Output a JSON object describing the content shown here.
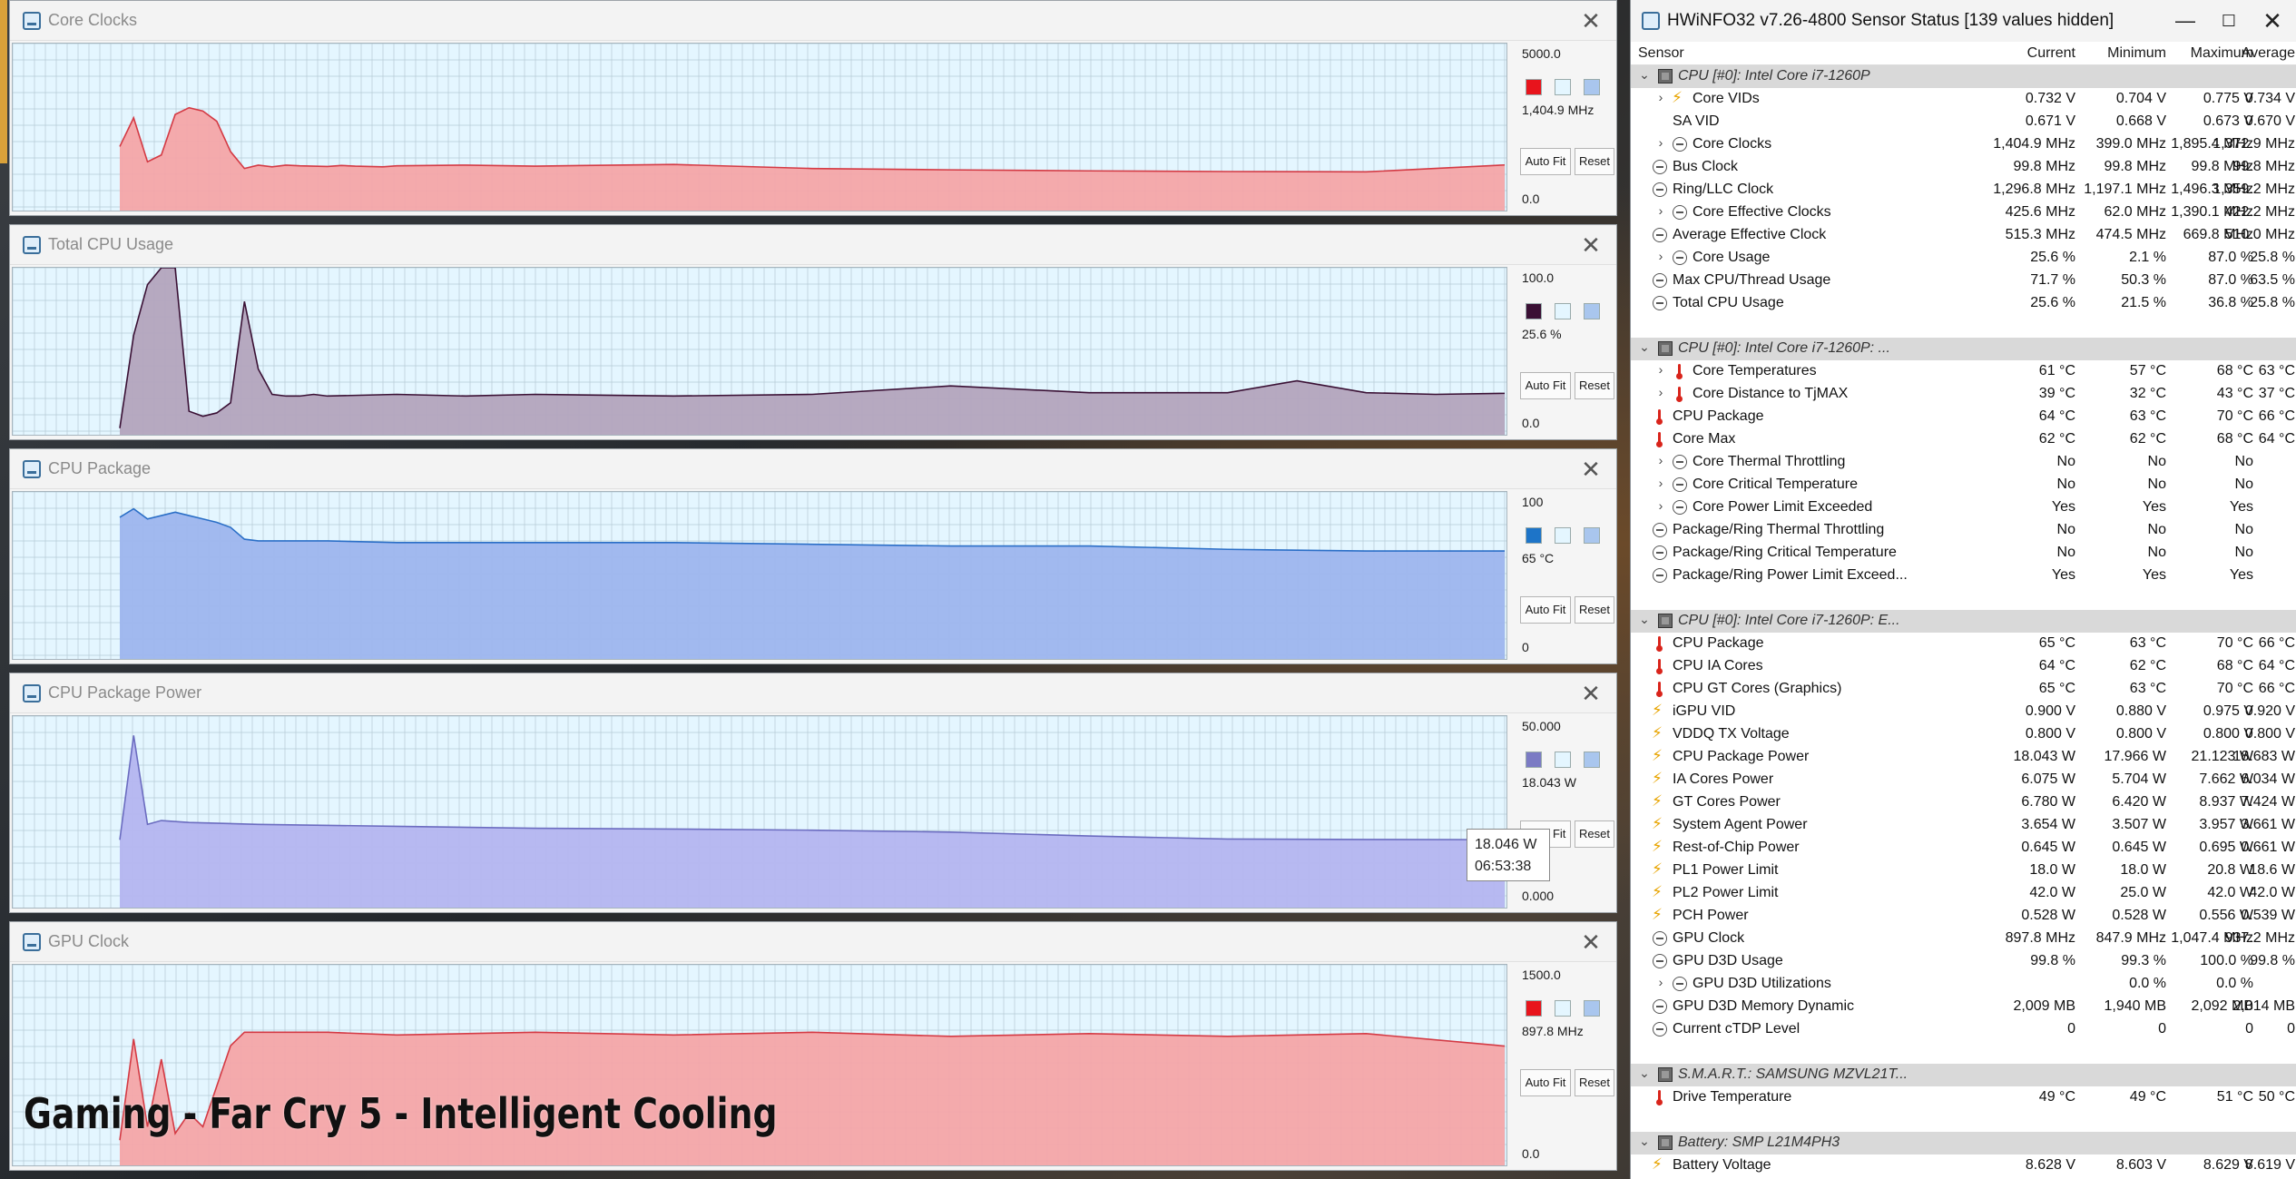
{
  "graph_windows": [
    {
      "title": "Core Clocks",
      "ymax": "5000.0",
      "ymin": "0.0",
      "current": "1,404.9 MHz",
      "series_color": "#e8141c",
      "fill": "#f4a5a8",
      "line": "#d43a44",
      "buttons": {
        "autofit": "Auto Fit",
        "reset": "Reset"
      },
      "chart_data": {
        "type": "area",
        "ylim": [
          0,
          5000
        ],
        "x": [
          0,
          1,
          2,
          3,
          4,
          5,
          6,
          7,
          8,
          9,
          10,
          11,
          12,
          13,
          14,
          15,
          16,
          17,
          18,
          19,
          20,
          25,
          30,
          40,
          50,
          60,
          70,
          80,
          90,
          100
        ],
        "values": [
          1950,
          2800,
          1500,
          1700,
          2900,
          3100,
          3000,
          2700,
          1800,
          1300,
          1400,
          1350,
          1400,
          1380,
          1370,
          1360,
          1390,
          1370,
          1360,
          1350,
          1380,
          1400,
          1370,
          1420,
          1300,
          1260,
          1230,
          1210,
          1200,
          1404.9
        ]
      }
    },
    {
      "title": "Total CPU Usage",
      "ymax": "100.0",
      "ymin": "0.0",
      "current": "25.6 %",
      "series_color": "#3a1034",
      "fill": "#b3a4bd",
      "line": "#3a1034",
      "buttons": {
        "autofit": "Auto Fit",
        "reset": "Reset"
      },
      "chart_data": {
        "type": "area",
        "ylim": [
          0,
          100
        ],
        "x": [
          0,
          1,
          2,
          3,
          4,
          5,
          6,
          7,
          8,
          9,
          10,
          11,
          12,
          13,
          14,
          15,
          20,
          25,
          30,
          40,
          50,
          60,
          70,
          80,
          85,
          90,
          95,
          100
        ],
        "values": [
          5,
          60,
          90,
          100,
          100,
          15,
          12,
          14,
          20,
          80,
          40,
          25,
          24,
          24,
          25,
          24,
          25,
          24,
          25,
          24,
          25,
          30,
          26,
          26,
          33,
          26,
          25,
          25.6
        ]
      }
    },
    {
      "title": "CPU Package",
      "ymax": "100",
      "ymin": "0",
      "current": "65 °C",
      "series_color": "#1d74c8",
      "fill": "#9db5ee",
      "line": "#2b6fc7",
      "buttons": {
        "autofit": "Auto Fit",
        "reset": "Reset"
      },
      "chart_data": {
        "type": "area",
        "ylim": [
          0,
          100
        ],
        "x": [
          0,
          1,
          2,
          3,
          4,
          5,
          6,
          7,
          8,
          9,
          10,
          15,
          20,
          30,
          40,
          50,
          60,
          70,
          80,
          90,
          100
        ],
        "values": [
          85,
          90,
          84,
          86,
          88,
          86,
          84,
          82,
          79,
          72,
          71,
          71,
          70,
          70,
          70,
          69,
          68,
          68,
          66,
          65,
          65
        ]
      }
    },
    {
      "title": "CPU Package Power",
      "ymax": "50.000",
      "ymin": "0.000",
      "current": "18.043 W",
      "series_color": "#7b7bc4",
      "fill": "#b4b5f0",
      "line": "#6b6cc0",
      "buttons": {
        "autofit": "Auto Fit",
        "reset": "Reset"
      },
      "chart_data": {
        "type": "area",
        "ylim": [
          0,
          50
        ],
        "x": [
          0,
          1,
          2,
          3,
          5,
          10,
          20,
          30,
          40,
          50,
          60,
          70,
          80,
          90,
          100
        ],
        "values": [
          18,
          45,
          22,
          23,
          22.5,
          22,
          21.5,
          21,
          20.8,
          20.5,
          20,
          19,
          18.2,
          18.1,
          18.043
        ]
      }
    },
    {
      "title": "GPU Clock",
      "ymax": "1500.0",
      "ymin": "0.0",
      "current": "897.8 MHz",
      "series_color": "#e8141c",
      "fill": "#f4a5a8",
      "line": "#d43a44",
      "buttons": {
        "autofit": "Auto Fit",
        "reset": "Reset"
      },
      "chart_data": {
        "type": "area",
        "ylim": [
          0,
          1500
        ],
        "x": [
          0,
          1,
          2,
          3,
          4,
          5,
          6,
          7,
          8,
          9,
          10,
          11,
          12,
          15,
          20,
          30,
          40,
          50,
          60,
          70,
          80,
          90,
          100
        ],
        "values": [
          200,
          950,
          300,
          800,
          250,
          400,
          300,
          600,
          900,
          1000,
          1000,
          1000,
          1000,
          1000,
          980,
          1000,
          980,
          1000,
          970,
          990,
          970,
          990,
          897.8
        ]
      }
    }
  ],
  "tooltip": {
    "value": "18.046 W",
    "time": "06:53:38"
  },
  "overlay_caption": "Gaming - Far Cry 5 - Intelligent Cooling",
  "sensor_window": {
    "title": "HWiNFO32 v7.26-4800 Sensor Status [139 values hidden]",
    "columns": [
      "Sensor",
      "Current",
      "Minimum",
      "Maximum",
      "Average"
    ],
    "rows": [
      {
        "type": "group",
        "icon": "chip",
        "label": "CPU [#0]: Intel Core i7-1260P",
        "exp": "v"
      },
      {
        "icon": "bolt",
        "label": "Core VIDs",
        "exp": ">",
        "v": [
          "0.732 V",
          "0.704 V",
          "0.775 V",
          "0.734 V"
        ]
      },
      {
        "icon": "",
        "label": "SA VID",
        "v": [
          "0.671 V",
          "0.668 V",
          "0.673 V",
          "0.670 V"
        ]
      },
      {
        "icon": "clock",
        "label": "Core Clocks",
        "exp": ">",
        "v": [
          "1,404.9 MHz",
          "399.0 MHz",
          "1,895.4 MHz",
          "1,372.9 MHz"
        ]
      },
      {
        "icon": "clock",
        "label": "Bus Clock",
        "v": [
          "99.8 MHz",
          "99.8 MHz",
          "99.8 MHz",
          "99.8 MHz"
        ]
      },
      {
        "icon": "clock",
        "label": "Ring/LLC Clock",
        "v": [
          "1,296.8 MHz",
          "1,197.1 MHz",
          "1,496.3 MHz",
          "1,359.2 MHz"
        ]
      },
      {
        "icon": "clock",
        "label": "Core Effective Clocks",
        "exp": ">",
        "v": [
          "425.6 MHz",
          "62.0 MHz",
          "1,390.1 MHz",
          "422.2 MHz"
        ]
      },
      {
        "icon": "clock",
        "label": "Average Effective Clock",
        "v": [
          "515.3 MHz",
          "474.5 MHz",
          "669.8 MHz",
          "510.0 MHz"
        ]
      },
      {
        "icon": "clock",
        "label": "Core Usage",
        "exp": ">",
        "v": [
          "25.6 %",
          "2.1 %",
          "87.0 %",
          "25.8 %"
        ]
      },
      {
        "icon": "clock",
        "label": "Max CPU/Thread Usage",
        "v": [
          "71.7 %",
          "50.3 %",
          "87.0 %",
          "63.5 %"
        ]
      },
      {
        "icon": "clock",
        "label": "Total CPU Usage",
        "v": [
          "25.6 %",
          "21.5 %",
          "36.8 %",
          "25.8 %"
        ]
      },
      {
        "type": "blank"
      },
      {
        "type": "group",
        "icon": "chip",
        "label": "CPU [#0]: Intel Core i7-1260P: ...",
        "exp": "v"
      },
      {
        "icon": "temp",
        "label": "Core Temperatures",
        "exp": ">",
        "v": [
          "61 °C",
          "57 °C",
          "68 °C",
          "63 °C"
        ]
      },
      {
        "icon": "temp",
        "label": "Core Distance to TjMAX",
        "exp": ">",
        "v": [
          "39 °C",
          "32 °C",
          "43 °C",
          "37 °C"
        ]
      },
      {
        "icon": "temp",
        "label": "CPU Package",
        "v": [
          "64 °C",
          "63 °C",
          "70 °C",
          "66 °C"
        ]
      },
      {
        "icon": "temp",
        "label": "Core Max",
        "v": [
          "62 °C",
          "62 °C",
          "68 °C",
          "64 °C"
        ]
      },
      {
        "icon": "clock",
        "label": "Core Thermal Throttling",
        "exp": ">",
        "v": [
          "No",
          "No",
          "No",
          ""
        ]
      },
      {
        "icon": "clock",
        "label": "Core Critical Temperature",
        "exp": ">",
        "v": [
          "No",
          "No",
          "No",
          ""
        ]
      },
      {
        "icon": "clock",
        "label": "Core Power Limit Exceeded",
        "exp": ">",
        "v": [
          "Yes",
          "Yes",
          "Yes",
          ""
        ]
      },
      {
        "icon": "clock",
        "label": "Package/Ring Thermal Throttling",
        "v": [
          "No",
          "No",
          "No",
          ""
        ]
      },
      {
        "icon": "clock",
        "label": "Package/Ring Critical Temperature",
        "v": [
          "No",
          "No",
          "No",
          ""
        ]
      },
      {
        "icon": "clock",
        "label": "Package/Ring Power Limit Exceed...",
        "v": [
          "Yes",
          "Yes",
          "Yes",
          ""
        ]
      },
      {
        "type": "blank"
      },
      {
        "type": "group",
        "icon": "chip",
        "label": "CPU [#0]: Intel Core i7-1260P: E...",
        "exp": "v"
      },
      {
        "icon": "temp",
        "label": "CPU Package",
        "v": [
          "65 °C",
          "63 °C",
          "70 °C",
          "66 °C"
        ]
      },
      {
        "icon": "temp",
        "label": "CPU IA Cores",
        "v": [
          "64 °C",
          "62 °C",
          "68 °C",
          "64 °C"
        ]
      },
      {
        "icon": "temp",
        "label": "CPU GT Cores (Graphics)",
        "v": [
          "65 °C",
          "63 °C",
          "70 °C",
          "66 °C"
        ]
      },
      {
        "icon": "bolt",
        "label": "iGPU VID",
        "v": [
          "0.900 V",
          "0.880 V",
          "0.975 V",
          "0.920 V"
        ]
      },
      {
        "icon": "bolt",
        "label": "VDDQ TX Voltage",
        "v": [
          "0.800 V",
          "0.800 V",
          "0.800 V",
          "0.800 V"
        ]
      },
      {
        "icon": "bolt",
        "label": "CPU Package Power",
        "v": [
          "18.043 W",
          "17.966 W",
          "21.123 W",
          "18.683 W"
        ]
      },
      {
        "icon": "bolt",
        "label": "IA Cores Power",
        "v": [
          "6.075 W",
          "5.704 W",
          "7.662 W",
          "6.034 W"
        ]
      },
      {
        "icon": "bolt",
        "label": "GT Cores Power",
        "v": [
          "6.780 W",
          "6.420 W",
          "8.937 W",
          "7.424 W"
        ]
      },
      {
        "icon": "bolt",
        "label": "System Agent Power",
        "v": [
          "3.654 W",
          "3.507 W",
          "3.957 W",
          "3.661 W"
        ]
      },
      {
        "icon": "bolt",
        "label": "Rest-of-Chip Power",
        "v": [
          "0.645 W",
          "0.645 W",
          "0.695 W",
          "0.661 W"
        ]
      },
      {
        "icon": "bolt",
        "label": "PL1 Power Limit",
        "v": [
          "18.0 W",
          "18.0 W",
          "20.8 W",
          "18.6 W"
        ]
      },
      {
        "icon": "bolt",
        "label": "PL2 Power Limit",
        "v": [
          "42.0 W",
          "25.0 W",
          "42.0 W",
          "42.0 W"
        ]
      },
      {
        "icon": "bolt",
        "label": "PCH Power",
        "v": [
          "0.528 W",
          "0.528 W",
          "0.556 W",
          "0.539 W"
        ]
      },
      {
        "icon": "clock",
        "label": "GPU Clock",
        "v": [
          "897.8 MHz",
          "847.9 MHz",
          "1,047.4 MHz",
          "937.2 MHz"
        ]
      },
      {
        "icon": "clock",
        "label": "GPU D3D Usage",
        "v": [
          "99.8 %",
          "99.3 %",
          "100.0 %",
          "99.8 %"
        ]
      },
      {
        "icon": "clock",
        "label": "GPU D3D Utilizations",
        "exp": ">",
        "v": [
          "",
          "0.0 %",
          "0.0 %",
          ""
        ]
      },
      {
        "icon": "clock",
        "label": "GPU D3D Memory Dynamic",
        "v": [
          "2,009 MB",
          "1,940 MB",
          "2,092 MB",
          "2,014 MB"
        ]
      },
      {
        "icon": "clock",
        "label": "Current cTDP Level",
        "v": [
          "0",
          "0",
          "0",
          "0"
        ]
      },
      {
        "type": "blank"
      },
      {
        "type": "group",
        "icon": "chip",
        "label": "S.M.A.R.T.: SAMSUNG MZVL21T...",
        "exp": "v"
      },
      {
        "icon": "temp",
        "label": "Drive Temperature",
        "v": [
          "49 °C",
          "49 °C",
          "51 °C",
          "50 °C"
        ]
      },
      {
        "type": "blank"
      },
      {
        "type": "group",
        "icon": "chip",
        "label": "Battery: SMP L21M4PH3",
        "exp": "v"
      },
      {
        "icon": "bolt",
        "label": "Battery Voltage",
        "v": [
          "8.628 V",
          "8.603 V",
          "8.629 V",
          "8.619 V"
        ]
      }
    ]
  }
}
